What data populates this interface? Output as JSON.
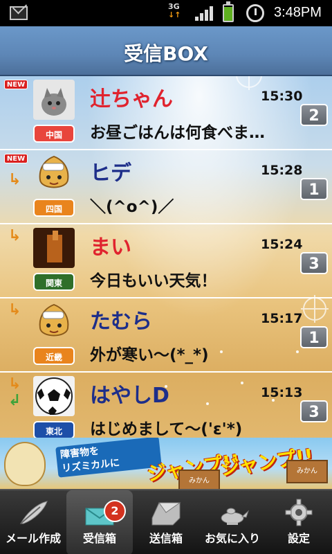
{
  "status_bar": {
    "network": "3G",
    "time": "3:48PM"
  },
  "header": {
    "title": "受信BOX"
  },
  "messages": [
    {
      "name": "辻ちゃん",
      "name_color": "#e0232e",
      "time": "15:30",
      "preview": "お昼ごはんは何食べま…",
      "region": "中国",
      "region_color": "#e8453c",
      "count": "2",
      "new_label": "NEW"
    },
    {
      "name": "ヒデ",
      "name_color": "#1d2e8a",
      "time": "15:28",
      "preview": "＼(^o^)／",
      "region": "四国",
      "region_color": "#e9841d",
      "count": "1",
      "new_label": "NEW"
    },
    {
      "name": "まい",
      "name_color": "#e0232e",
      "time": "15:24",
      "preview": "今日もいい天気！",
      "region": "関東",
      "region_color": "#2f6f2a",
      "count": "3"
    },
    {
      "name": "たむら",
      "name_color": "#1d2e8a",
      "time": "15:17",
      "preview": "外が寒い～(*_*)",
      "region": "近畿",
      "region_color": "#e9841d",
      "count": "1"
    },
    {
      "name": "はやしD",
      "name_color": "#1d2e8a",
      "time": "15:13",
      "preview": "はじめまして～('ε'*)",
      "region": "東北",
      "region_color": "#1d4fa8",
      "count": "3"
    }
  ],
  "banner": {
    "text_line1": "障害物を",
    "text_line2": "リズミカルに",
    "jump1": "ジャンプ!!",
    "jump2": "ジャンプ!!",
    "box_label1": "みかん",
    "box_label2": "みかん"
  },
  "tabs": [
    {
      "label": "メール作成",
      "icon": "feather-pen-icon"
    },
    {
      "label": "受信箱",
      "icon": "inbox-envelope-icon",
      "badge": "2"
    },
    {
      "label": "送信箱",
      "icon": "outbox-icon"
    },
    {
      "label": "お気に入り",
      "icon": "magic-lamp-icon"
    },
    {
      "label": "設定",
      "icon": "gear-icon"
    }
  ]
}
